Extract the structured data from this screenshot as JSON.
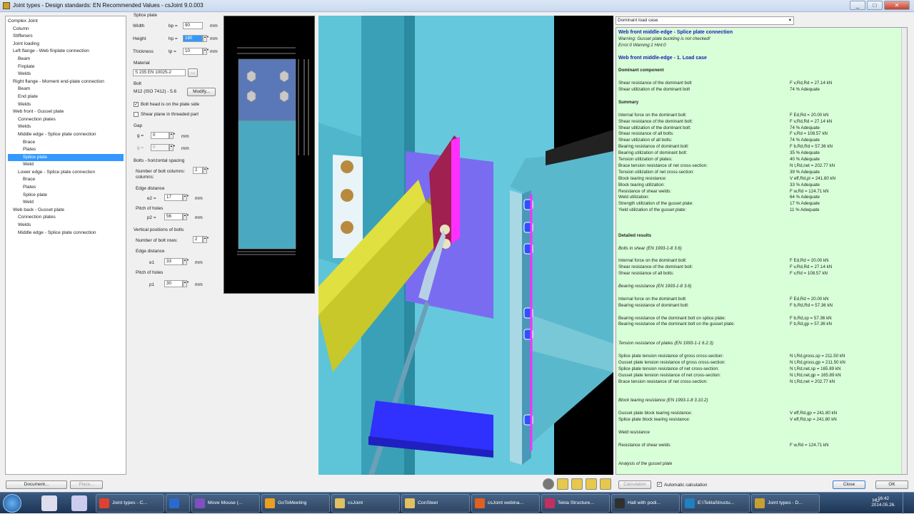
{
  "window": {
    "title": "Joint types - Design standards: EN Recommended Values - csJoint 9.0.003",
    "buttons": [
      "_",
      "□",
      "✕"
    ]
  },
  "tree": [
    {
      "label": "Complex Joint",
      "indent": 0
    },
    {
      "label": "Column",
      "indent": 1
    },
    {
      "label": "Stiffeners",
      "indent": 1
    },
    {
      "label": "Joint loading",
      "indent": 1
    },
    {
      "label": "Left flange - Web finplate connection",
      "indent": 1
    },
    {
      "label": "Beam",
      "indent": 2
    },
    {
      "label": "Finplate",
      "indent": 2
    },
    {
      "label": "Welds",
      "indent": 2
    },
    {
      "label": "Right flange - Moment end-plate connection",
      "indent": 1
    },
    {
      "label": "Beam",
      "indent": 2
    },
    {
      "label": "End plate",
      "indent": 2
    },
    {
      "label": "Welds",
      "indent": 2
    },
    {
      "label": "Web front - Gusset plate",
      "indent": 1
    },
    {
      "label": "Connection plates",
      "indent": 2
    },
    {
      "label": "Welds",
      "indent": 2
    },
    {
      "label": "Middle edge - Splice plate connection",
      "indent": 2
    },
    {
      "label": "Brace",
      "indent": 3
    },
    {
      "label": "Plates",
      "indent": 3
    },
    {
      "label": "Splice plate",
      "indent": 3,
      "selected": true
    },
    {
      "label": "Weld",
      "indent": 3
    },
    {
      "label": "Lower edge - Splice plate connection",
      "indent": 2
    },
    {
      "label": "Brace",
      "indent": 3
    },
    {
      "label": "Plates",
      "indent": 3
    },
    {
      "label": "Splice plate",
      "indent": 3
    },
    {
      "label": "Weld",
      "indent": 3
    },
    {
      "label": "Web back - Gusset plate",
      "indent": 1
    },
    {
      "label": "Connection plates",
      "indent": 2
    },
    {
      "label": "Welds",
      "indent": 2
    },
    {
      "label": "Middle edge - Splice plate connection",
      "indent": 2
    }
  ],
  "form": {
    "section": "Splice plate",
    "width": {
      "label": "Width",
      "sym": "bp =",
      "value": "90",
      "unit": "mm"
    },
    "height": {
      "label": "Height",
      "sym": "hp =",
      "value": "180",
      "unit": "mm"
    },
    "thickness": {
      "label": "Thickness",
      "sym": "tp =",
      "value": "10",
      "unit": "mm"
    },
    "material_label": "Material",
    "material": "S 235 EN 10025-2",
    "bolt_label": "Bolt",
    "bolt": "M12 (ISO 7412) - 5.6",
    "modify": "Modify...",
    "chk1": "Bolt head is on the plate side",
    "chk2": "Shear plane in threaded part",
    "gap_label": "Gap",
    "g1": {
      "sym": "g =",
      "value": "0",
      "unit": "mm"
    },
    "g2": {
      "sym": "g =",
      "value": "0",
      "unit": "mm"
    },
    "bolts_h": "Bolts - horizontal spacing",
    "cols_label": "Number of bolt columns:",
    "cols_label2": "columns:",
    "cols": "2",
    "edge_label": "Edge distance",
    "e2": {
      "sym": "e2 =",
      "value": "17",
      "unit": "mm"
    },
    "pitch_label": "Pitch of holes",
    "p2": {
      "sym": "p2 =",
      "value": "56",
      "unit": "mm"
    },
    "vert": "Vertical positions of bolts",
    "rows_label": "Number of bolt rows:",
    "rows": "2",
    "edge_label2": "Edge distance",
    "e1": {
      "sym": "e1",
      "value": "33",
      "unit": "mm"
    },
    "pitch_label2": "Pitch of holes",
    "p1": {
      "sym": "p1",
      "value": "30",
      "unit": "mm"
    }
  },
  "dropdown": "Dominant load case",
  "results": [
    {
      "l": "Web front middle-edge - Splice plate connection",
      "c": "h"
    },
    {
      "l": "Warning: Gusset plate buckling is not checked!",
      "c": "it"
    },
    {
      "l": "Error:0   Warning:1   Hint:0",
      "c": "it"
    },
    {
      "l": "",
      "c": ""
    },
    {
      "l": "Web front middle-edge - 1. Load case",
      "c": "h"
    },
    {
      "l": "",
      "c": ""
    },
    {
      "l": "Dominant component",
      "c": "hd"
    },
    {
      "l": "",
      "c": ""
    },
    {
      "l": "Shear resistance of the dominant bolt",
      "v": "F v,Rd,Rd = 27.14 kN"
    },
    {
      "l": "Shear utilization of the dominant bolt",
      "v": "74 % Adequate"
    },
    {
      "l": "",
      "c": ""
    },
    {
      "l": "Summary",
      "c": "hd"
    },
    {
      "l": "",
      "c": ""
    },
    {
      "l": "Internal force on the dominant bolt:",
      "v": "F Ed,Rd = 20.00 kN"
    },
    {
      "l": "Shear resistance of the dominant bolt:",
      "v": "F v,Rd,Rd = 27.14 kN"
    },
    {
      "l": "Shear utilization of the dominant bolt:",
      "v": "74 % Adequate"
    },
    {
      "l": "Shear resistance of all bolts:",
      "v": "F v,Rd = 108.57 kN"
    },
    {
      "l": "Shear utilization of all bolts:",
      "v": "74 % Adequate"
    },
    {
      "l": "Bearing resistance of dominant bolt:",
      "v": "F b,Rd,Rd = 57.36 kN"
    },
    {
      "l": "Bearing utilization of dominant bolt:",
      "v": "35 % Adequate"
    },
    {
      "l": "Tension utilization of plates:",
      "v": "40 % Adequate"
    },
    {
      "l": "Brace tension resistance of net cross-section:",
      "v": "N t,Rd,net = 202.77 kN"
    },
    {
      "l": "Tension utilization of net cross-section:",
      "v": "39 % Adequate"
    },
    {
      "l": "Block tearing resistance:",
      "v": "V eff,Rd,pl = 241.80 kN"
    },
    {
      "l": "Block tearing utilization:",
      "v": "33 % Adequate"
    },
    {
      "l": "Resistance of shear welds:",
      "v": "F w,Rd = 124.71 kN"
    },
    {
      "l": "Weld utilization:",
      "v": "64 % Adequate"
    },
    {
      "l": "Strength utilization of the gusset plate:",
      "v": "17 % Adequate"
    },
    {
      "l": "Yield utilization of the gusset plate:",
      "v": "11 % Adequate"
    },
    {
      "l": "",
      "c": ""
    },
    {
      "l": "",
      "c": ""
    },
    {
      "l": "",
      "c": ""
    },
    {
      "l": "Detailed results",
      "c": "hd"
    },
    {
      "l": "",
      "c": ""
    },
    {
      "l": "Bolts in shear (EN 1993-1-8 3.6)",
      "c": "it"
    },
    {
      "l": "",
      "c": ""
    },
    {
      "l": "Internal force on the dominant bolt:",
      "v": "F Ed,Rd = 20.00 kN"
    },
    {
      "l": "Shear resistance of the dominant bolt:",
      "v": "F v,Rd,Rd = 27.14 kN"
    },
    {
      "l": "Shear resistance of all bolts:",
      "v": "F v,Rd = 108.57 kN"
    },
    {
      "l": "",
      "c": ""
    },
    {
      "l": "Bearing resistance (EN 1993-1-8 3.6)",
      "c": "it"
    },
    {
      "l": "",
      "c": ""
    },
    {
      "l": "Internal force on the dominant bolt:",
      "v": "F Ed,Rd = 20.00 kN"
    },
    {
      "l": "Bearing resistance of dominant bolt:",
      "v": "F b,Rd,Rd = 57.36 kN"
    },
    {
      "l": "",
      "c": ""
    },
    {
      "l": "Bearing resistance of the dominant bolt on splice plate:",
      "v": "F b,Rd,sp = 57.36 kN"
    },
    {
      "l": "Bearing resistance of the dominant bolt on the gusset plate:",
      "v": "F b,Rd,gp = 57.36 kN"
    },
    {
      "l": "",
      "c": ""
    },
    {
      "l": "",
      "c": ""
    },
    {
      "l": "Tension resistance of plates (EN 1993-1-1 6.2.3)",
      "c": "it"
    },
    {
      "l": "",
      "c": ""
    },
    {
      "l": "Splice plate tension resistance of gross cross-section:",
      "v": "N t,Rd,gross,sp = 211.50 kN"
    },
    {
      "l": "Gusset plate tension resistance of gross cross-section:",
      "v": "N t,Rd,gross,gp = 211.50 kN"
    },
    {
      "l": "Splice plate tension resistance of net cross-section:",
      "v": "N t,Rd,net,sp = 165.89 kN"
    },
    {
      "l": "Gusset plate tension resistance of net cross-section:",
      "v": "N t,Rd,net,gp = 165.89 kN"
    },
    {
      "l": "Brace tension resistance of net cross-section:",
      "v": "N t,Rd,net = 202.77 kN"
    },
    {
      "l": "",
      "c": ""
    },
    {
      "l": "",
      "c": ""
    },
    {
      "l": "Block tearing resistance (EN 1993-1-8 3.10.2)",
      "c": "it"
    },
    {
      "l": "",
      "c": ""
    },
    {
      "l": "Gusset plate block tearing resistance:",
      "v": "V eff,Rd,gp = 241.80 kN"
    },
    {
      "l": "Splice plate block tearing resistance:",
      "v": "V eff,Rd,sp = 241.80 kN"
    },
    {
      "l": "",
      "c": ""
    },
    {
      "l": "Weld resistance",
      "c": "it"
    },
    {
      "l": "",
      "c": ""
    },
    {
      "l": "Resistance of shear welds:",
      "v": "F w,Rd = 124.71 kN"
    },
    {
      "l": "",
      "c": ""
    },
    {
      "l": "",
      "c": ""
    },
    {
      "l": "Analysis of the gusset plate",
      "c": "it"
    }
  ],
  "bottom": {
    "document": "Document...",
    "place": "Place...",
    "calculation": "Calculation",
    "auto_calc": "Automatic calculation",
    "close": "Close",
    "ok": "OK"
  },
  "taskbar": {
    "items": [
      "Joint types - C...",
      "",
      "Move Mouse (...",
      "GoToMeeting",
      "csJoint",
      "ConSteel",
      "csJoint webina...",
      "Tekla Structure...",
      "Hall with podi...",
      "E:\\TeklaStructu...",
      "Joint types - D..."
    ],
    "lang": "HU",
    "time": "16:42",
    "date": "2014.05.26."
  }
}
